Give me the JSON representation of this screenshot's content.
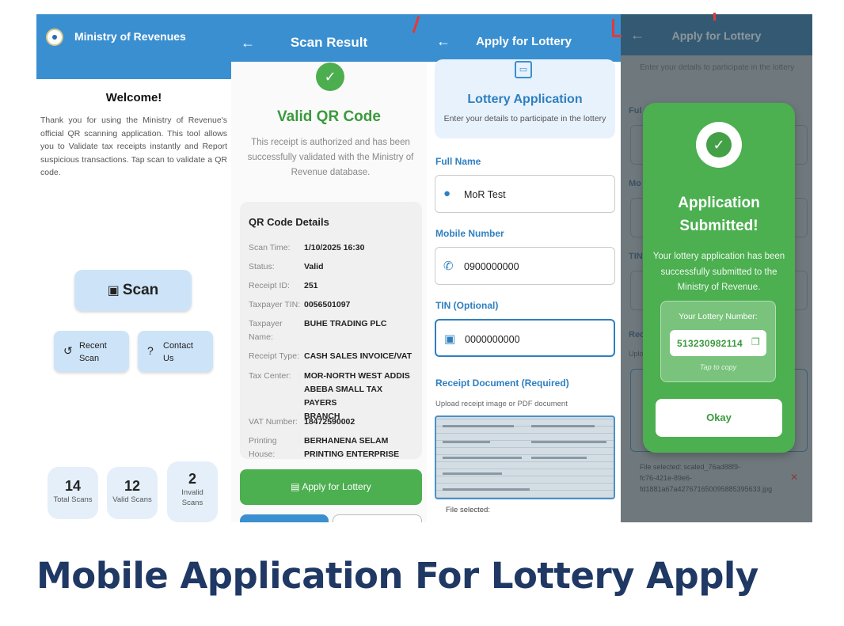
{
  "screen1": {
    "app_title": "Ministry of Revenues",
    "welcome": "Welcome!",
    "intro": "Thank you for using the Ministry of Revenue's official QR scanning application. This tool allows you to Validate tax receipts instantly and Report suspicious transactions. Tap scan to validate a QR code.",
    "scan_label": "Scan",
    "recent_scan_label": "Recent\nScan",
    "contact_us_label": "Contact\nUs",
    "stats": [
      {
        "value": "14",
        "label": "Total Scans"
      },
      {
        "value": "12",
        "label": "Valid Scans"
      },
      {
        "value": "2",
        "label": "Invalid\nScans"
      }
    ]
  },
  "screen2": {
    "title": "Scan Result",
    "status_title": "Valid QR Code",
    "status_desc": "This receipt is authorized and has been successfully validated with the Ministry of Revenue database.",
    "details_heading": "QR Code Details",
    "details": [
      {
        "key": "Scan Time:",
        "value": "1/10/2025 16:30"
      },
      {
        "key": "Status:",
        "value": "Valid"
      },
      {
        "key": "Receipt ID:",
        "value": "251"
      },
      {
        "key": "Taxpayer TIN:",
        "value": "0056501097"
      },
      {
        "key": "Taxpayer\nName:",
        "value": "BUHE TRADING PLC"
      },
      {
        "key": "Receipt Type:",
        "value": "CASH SALES INVOICE/VAT"
      },
      {
        "key": "Tax Center:",
        "value": "MOR-NORTH WEST ADDIS\nABEBA SMALL TAX PAYERS\nBRANCH"
      },
      {
        "key": "VAT Number:",
        "value": "18472590002"
      },
      {
        "key": "Printing\nHouse:",
        "value": "BERHANENA SELAM\nPRINTING ENTERPRISE"
      }
    ],
    "apply_button": "Apply for Lottery"
  },
  "screen3": {
    "title": "Apply for Lottery",
    "card_title": "Lottery Application",
    "card_subtitle": "Enter your details to participate in the lottery",
    "full_name_label": "Full Name",
    "full_name_value": "MoR Test",
    "mobile_label": "Mobile Number",
    "mobile_value": "0900000000",
    "tin_label": "TIN (Optional)",
    "tin_value": "0000000000",
    "receipt_label": "Receipt Document (Required)",
    "receipt_hint": "Upload receipt image or PDF document",
    "file_selected": "File selected:"
  },
  "screen4": {
    "title": "Apply for Lottery",
    "bg_hint": "Enter your details to participate in the lottery",
    "bg_labels": [
      "Ful",
      "Mo",
      "TIN",
      "Rec"
    ],
    "bg_upload": "Uplo",
    "file_selected": "File selected: scaled_76ad88f9-\nfc76-421e-89e6-\nfd1881a67a427671650095885395633.jpg",
    "dialog": {
      "title": "Application\nSubmitted!",
      "message": "Your lottery application has been successfully submitted to the Ministry of Revenue.",
      "number_label": "Your Lottery Number:",
      "lottery_number": "513230982114",
      "tap_hint": "Tap to copy",
      "okay_button": "Okay"
    }
  },
  "caption": "Mobile Application For Lottery Apply",
  "colors": {
    "appbar_blue": "#3a8fd0",
    "success_green": "#4caf50",
    "caption_navy": "#1f3864",
    "annotation_red": "#e53935"
  }
}
